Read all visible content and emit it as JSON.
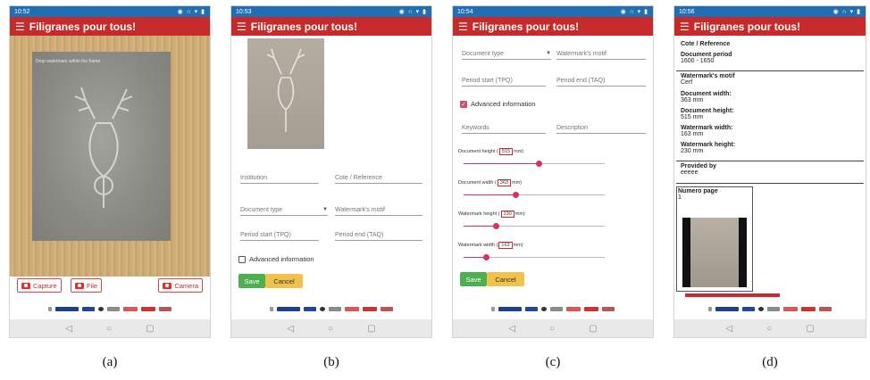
{
  "app": {
    "title": "Filigranes pour tous!"
  },
  "panels": [
    {
      "caption": "(a)",
      "time": "10:52"
    },
    {
      "caption": "(b)",
      "time": "10:53"
    },
    {
      "caption": "(c)",
      "time": "10:54"
    },
    {
      "caption": "(d)",
      "time": "10:56"
    }
  ],
  "capture_screen": {
    "hint": "Drop watermark within the frame",
    "capture_label": "Capture",
    "file_label": "File",
    "camera_label": "Camera"
  },
  "form": {
    "institution_placeholder": "Institution",
    "cote_placeholder": "Cote / Reference",
    "document_type_placeholder": "Document type",
    "watermark_motif_placeholder": "Watermark's motif",
    "period_start_placeholder": "Period start (TPQ)",
    "period_end_placeholder": "Period end (TAQ)",
    "advanced_label": "Advanced information",
    "keywords_placeholder": "Keywords",
    "description_placeholder": "Description",
    "save_label": "Save",
    "cancel_label": "Cancel"
  },
  "sliders": [
    {
      "label_pre": "Document height (",
      "value": "515",
      "label_post": "mm)",
      "fraction": 0.53
    },
    {
      "label_pre": "Document width (",
      "value": "363",
      "label_post": "mm)",
      "fraction": 0.37
    },
    {
      "label_pre": "Watermark height (",
      "value": "230",
      "label_post": "mm)",
      "fraction": 0.23
    },
    {
      "label_pre": "Watermark width (",
      "value": "163",
      "label_post": "mm)",
      "fraction": 0.16
    }
  ],
  "details": {
    "cote_label": "Cote / Reference",
    "period_label": "Document period",
    "period_value": "1600 - 1650",
    "motif_label": "Watermark's motif",
    "motif_value": "Cerf",
    "doc_width_label": "Document width:",
    "doc_width_value": "363 mm",
    "doc_height_label": "Document height:",
    "doc_height_value": "515 mm",
    "wm_width_label": "Watermark width:",
    "wm_width_value": "163 mm",
    "wm_height_label": "Watermark height:",
    "wm_height_value": "230 mm",
    "provided_label": "Provided by",
    "provided_value": "eeeee",
    "page_label": "Numero page",
    "page_value": "1"
  },
  "nav": {
    "back": "◁",
    "home": "○",
    "recent": "▢"
  },
  "colors": {
    "app_bar": "#c62a2a",
    "status_bar": "#1f6fb2",
    "save": "#4caf50",
    "cancel": "#f0c24b",
    "accent": "#d9325a"
  }
}
